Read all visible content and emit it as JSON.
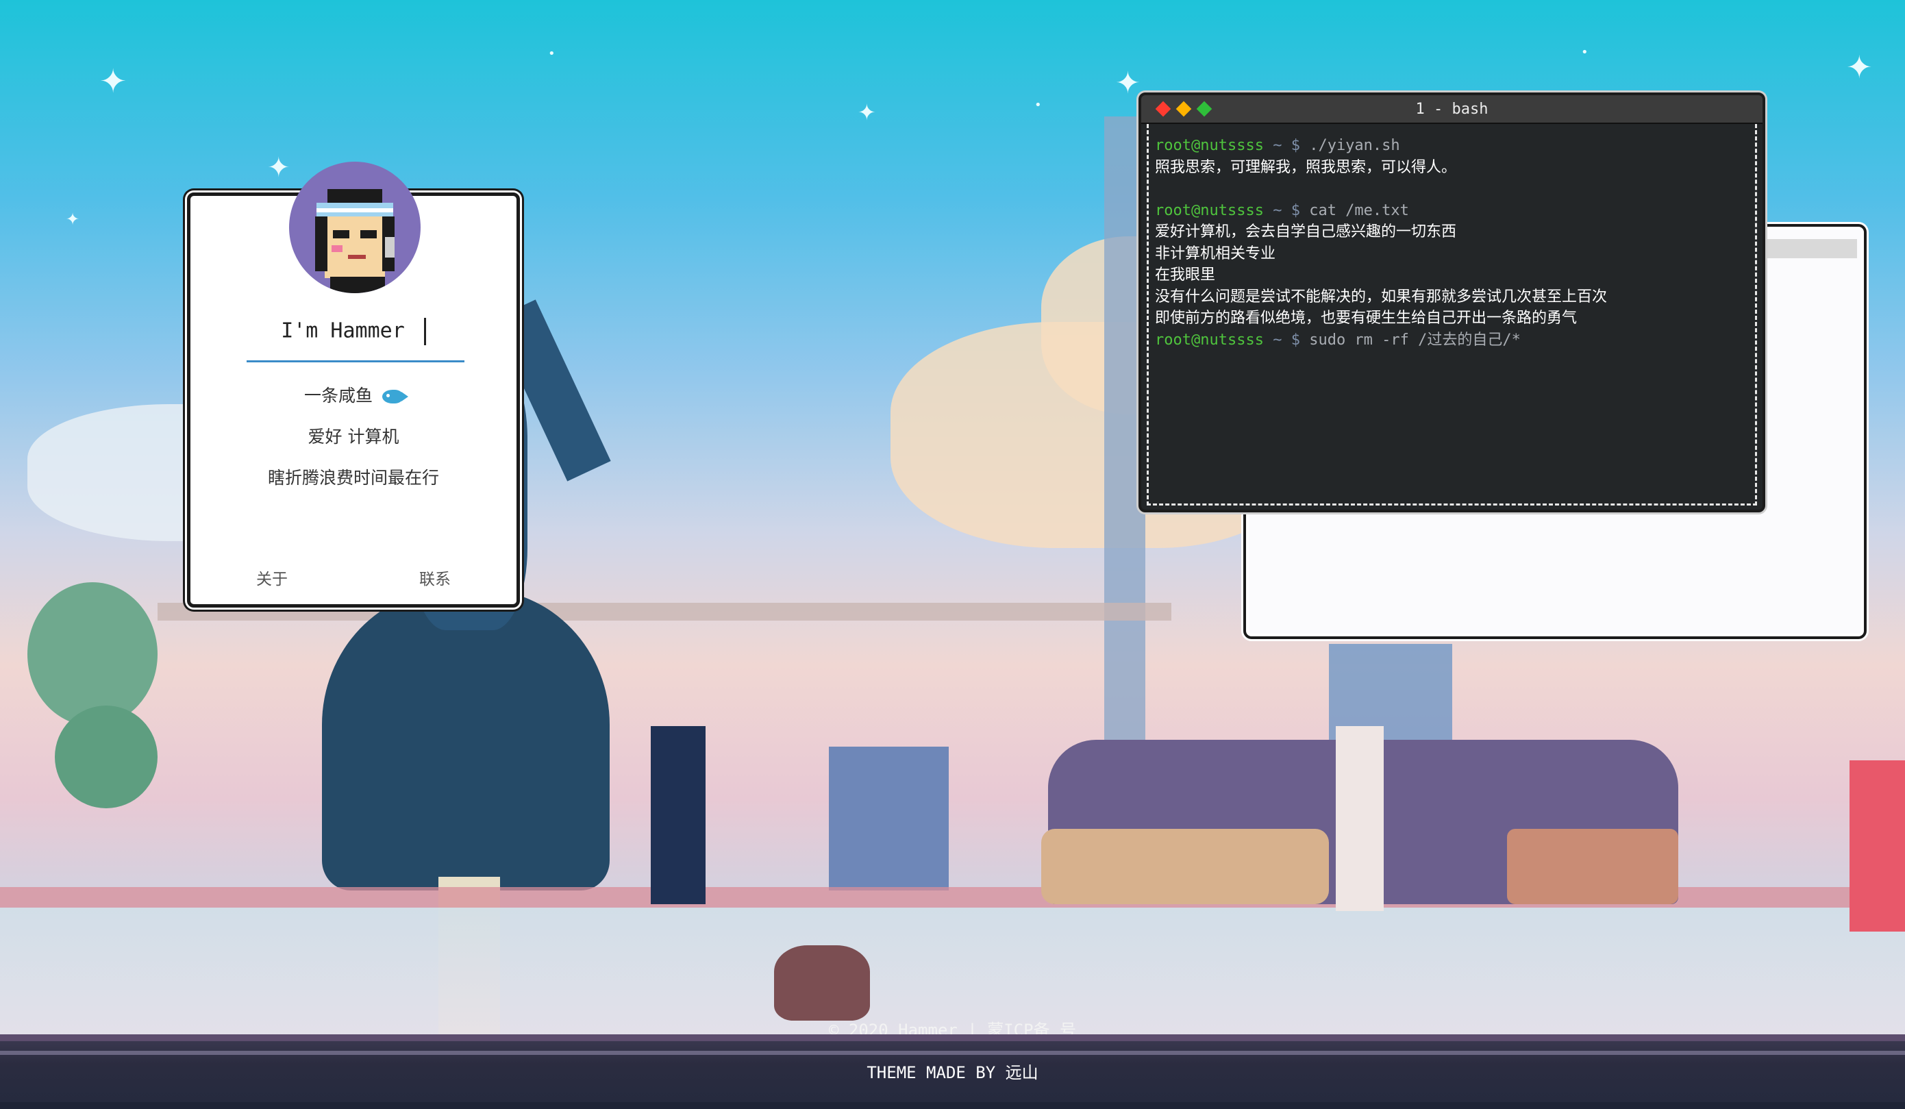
{
  "profile": {
    "name": "I'm Hammer",
    "lines": [
      "一条咸鱼",
      "爱好 计算机",
      "瞎折腾浪费时间最在行"
    ],
    "links": [
      "关于",
      "联系"
    ]
  },
  "terminal": {
    "title": "1 - bash",
    "user": "root@nutssss",
    "tilde": "~",
    "dollar": "$",
    "cmd1": "./yiyan.sh",
    "out1": "照我思索，可理解我，照我思索，可以得人。",
    "cmd2": "cat /me.txt",
    "out2": [
      "爱好计算机，会去自学自己感兴趣的一切东西",
      "非计算机相关专业",
      "在我眼里",
      "没有什么问题是尝试不能解决的，如果有那就多尝试几次甚至上百次",
      "即使前方的路看似绝境，也要有硬生生给自己开出一条路的勇气"
    ],
    "cmd3": "sudo rm -rf /过去的自己/*",
    "dot_colors": [
      "#ff3b30",
      "#ffb300",
      "#2fbf3a"
    ]
  },
  "footer": {
    "copyright": "© 2020 Hammer | 蒙ICP备 号",
    "made_by": "THEME MADE BY 远山"
  }
}
